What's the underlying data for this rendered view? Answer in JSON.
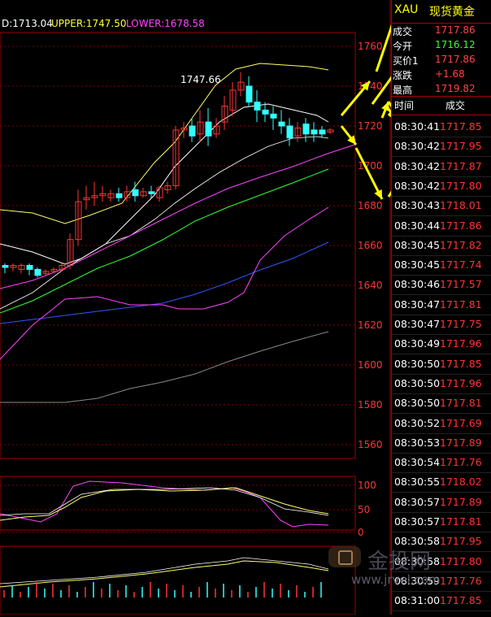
{
  "indicator": {
    "mid": "D:1713.04",
    "upper": "UPPER:1747.50",
    "lower": "LOWER:1678.58"
  },
  "price_axis": [
    "1760",
    "1740",
    "1720",
    "1700",
    "1680",
    "1660",
    "1640",
    "1620",
    "1600",
    "1580",
    "1560"
  ],
  "osc_axis": [
    "100",
    "50",
    "0"
  ],
  "high_label": "1747.66",
  "symbol": {
    "code": "XAU",
    "name": "现货黄金"
  },
  "quote": [
    {
      "label": "成交",
      "value": "1717.86",
      "color": "#ff4444"
    },
    {
      "label": "今开",
      "value": "1716.12",
      "color": "#33ff33"
    },
    {
      "label": "买价1",
      "value": "1717.86",
      "color": "#ff4444"
    },
    {
      "label": "涨跌",
      "value": "+1.68",
      "color": "#ff4444"
    },
    {
      "label": "最高",
      "value": "1719.82",
      "color": "#ff4444"
    }
  ],
  "ticks_header": {
    "time": "时间",
    "price": "成交"
  },
  "ticks": [
    {
      "time": "08:30:41",
      "price": "1717.85"
    },
    {
      "time": "08:30:42",
      "price": "1717.95"
    },
    {
      "time": "08:30:42",
      "price": "1717.87"
    },
    {
      "time": "08:30:42",
      "price": "1717.80"
    },
    {
      "time": "08:30:43",
      "price": "1718.01"
    },
    {
      "time": "08:30:44",
      "price": "1717.86"
    },
    {
      "time": "08:30:45",
      "price": "1717.82"
    },
    {
      "time": "08:30:45",
      "price": "1717.74"
    },
    {
      "time": "08:30:46",
      "price": "1717.57"
    },
    {
      "time": "08:30:47",
      "price": "1717.81"
    },
    {
      "time": "08:30:47",
      "price": "1717.75"
    },
    {
      "time": "08:30:49",
      "price": "1717.96"
    },
    {
      "time": "08:30:50",
      "price": "1717.85"
    },
    {
      "time": "08:30:50",
      "price": "1717.96"
    },
    {
      "time": "08:30:50",
      "price": "1717.81"
    },
    {
      "time": "08:30:52",
      "price": "1717.69"
    },
    {
      "time": "08:30:53",
      "price": "1717.89"
    },
    {
      "time": "08:30:54",
      "price": "1717.76"
    },
    {
      "time": "08:30:55",
      "price": "1718.02"
    },
    {
      "time": "08:30:57",
      "price": "1717.89"
    },
    {
      "time": "08:30:57",
      "price": "1717.81"
    },
    {
      "time": "08:30:58",
      "price": "1717.95"
    },
    {
      "time": "08:30:58",
      "price": "1717.80"
    },
    {
      "time": "08:30:59",
      "price": "1717.76"
    },
    {
      "time": "08:31:00",
      "price": "1717.85"
    }
  ],
  "watermark": {
    "logo": "金投网",
    "url": "www.jrvel.com"
  },
  "colors": {
    "up": "#ff3333",
    "down": "#33ffff",
    "grid": "#a00000",
    "arrow": "#ffff00",
    "upper_band": "#ffff66",
    "mid": "#ffffff",
    "ma_magenta": "#ff44ff",
    "ma_green": "#33ff33",
    "ma_blue": "#3355ff",
    "ma_gray": "#888888"
  }
}
